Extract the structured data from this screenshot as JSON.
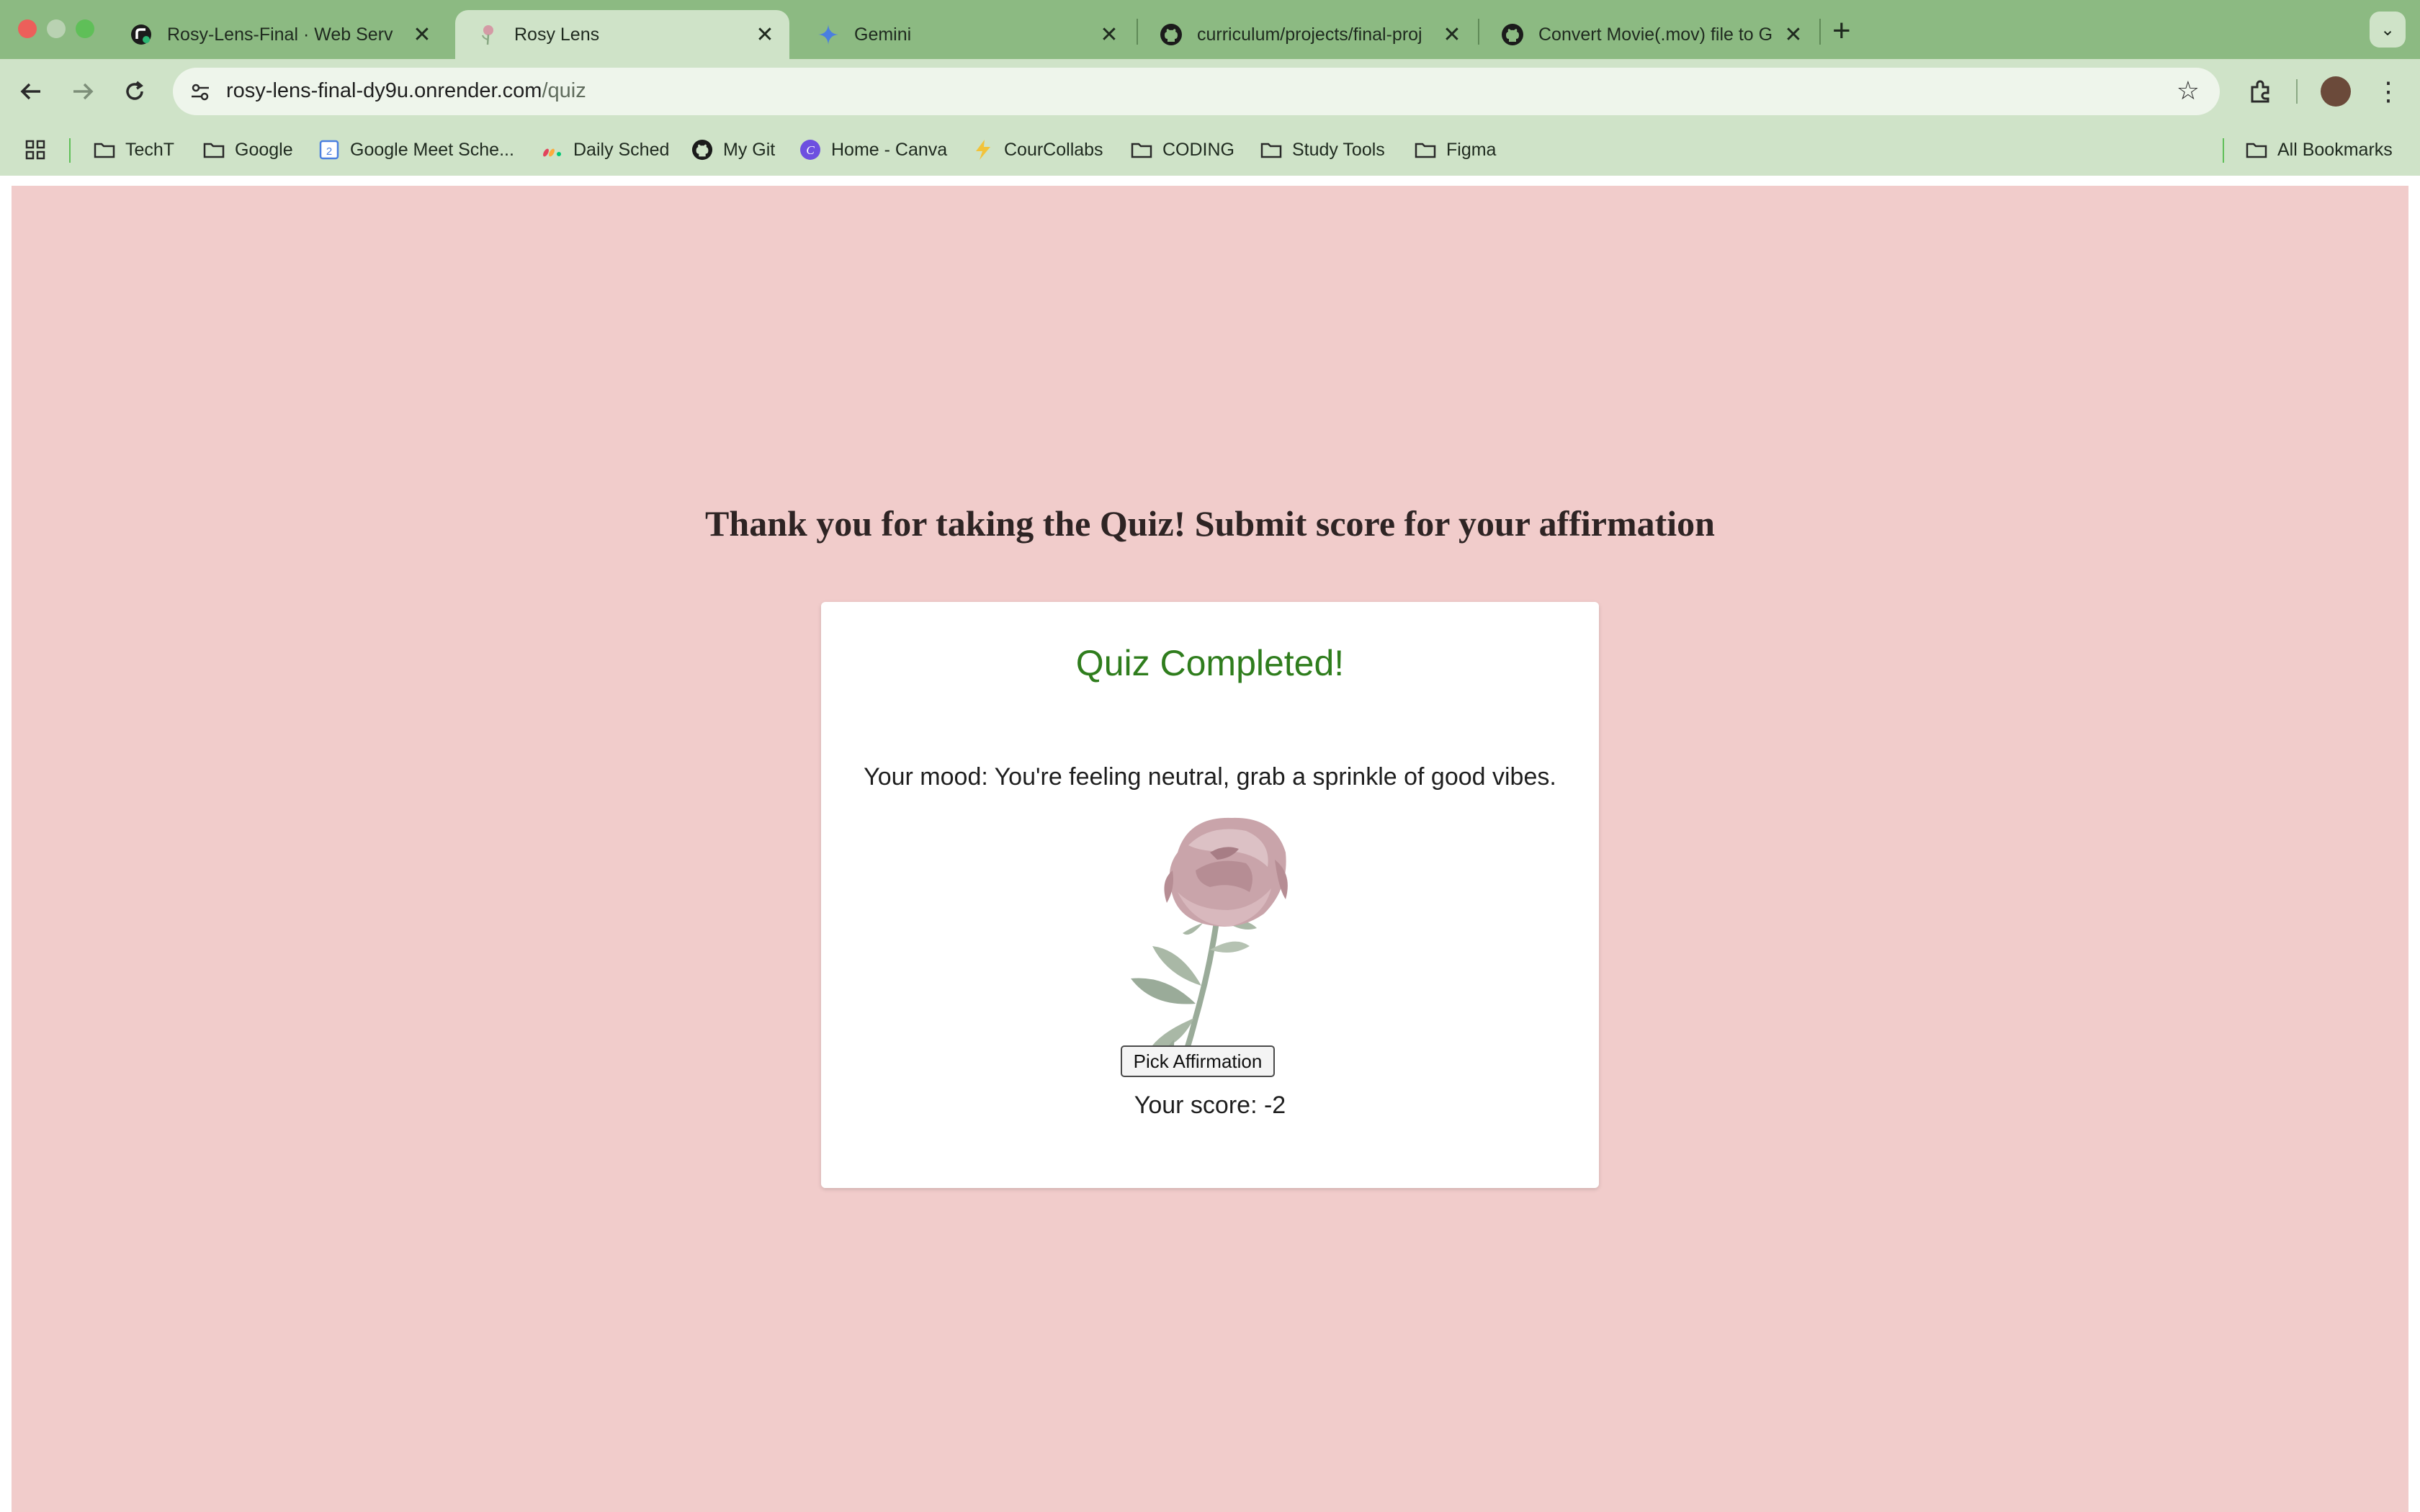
{
  "browser": {
    "tabs": [
      {
        "title": "Rosy-Lens-Final · Web Serv",
        "active": false,
        "icon": "render-icon"
      },
      {
        "title": "Rosy Lens",
        "active": true,
        "icon": "rose-favicon-icon"
      },
      {
        "title": "Gemini",
        "active": false,
        "icon": "gemini-icon"
      },
      {
        "title": "curriculum/projects/final-proj",
        "active": false,
        "icon": "github-icon"
      },
      {
        "title": "Convert Movie(.mov) file to G",
        "active": false,
        "icon": "github-icon"
      }
    ],
    "close_glyph": "✕",
    "new_tab_glyph": "+",
    "url_host": "rosy-lens-final-dy9u.onrender.com",
    "url_path": "/quiz",
    "bookmarks": [
      {
        "label": "TechT",
        "icon": "folder-icon"
      },
      {
        "label": "Google",
        "icon": "folder-icon"
      },
      {
        "label": "Google Meet Sche...",
        "icon": "calendar-icon"
      },
      {
        "label": "Daily Sched",
        "icon": "monday-icon"
      },
      {
        "label": "My Git",
        "icon": "github-icon"
      },
      {
        "label": "Home - Canva",
        "icon": "canva-icon"
      },
      {
        "label": "CourCollabs",
        "icon": "lightning-icon"
      },
      {
        "label": "CODING",
        "icon": "folder-icon"
      },
      {
        "label": "Study Tools",
        "icon": "folder-icon"
      },
      {
        "label": "Figma",
        "icon": "folder-icon"
      }
    ],
    "all_bookmarks": "All Bookmarks",
    "colors": {
      "frame": "#8cba82",
      "toolbar": "#cfe3c8"
    }
  },
  "page": {
    "heading": "Thank you for taking the Quiz! Submit score for your affirmation",
    "card_title": "Quiz Completed!",
    "mood": "Your mood: You're feeling neutral, grab a sprinkle of good vibes.",
    "score": "Your score: -2",
    "button": "Pick Affirmation",
    "colors": {
      "background": "#f1cccb",
      "title": "#2f7d1d"
    }
  }
}
